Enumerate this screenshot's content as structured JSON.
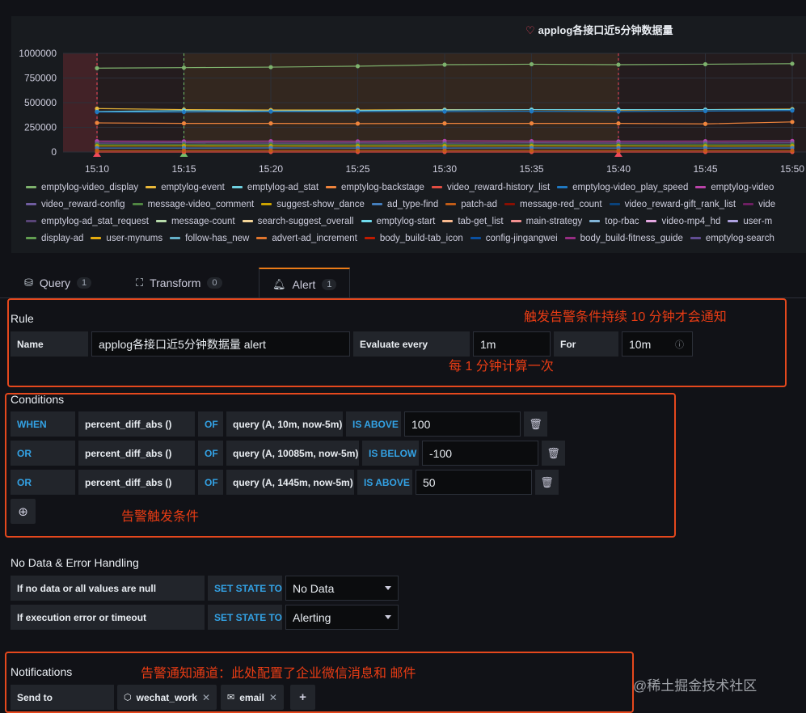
{
  "chart": {
    "title": "applog各接口近5分钟数据量"
  },
  "chart_data": {
    "type": "line",
    "title": "applog各接口近5分钟数据量",
    "x": [
      "15:10",
      "15:15",
      "15:20",
      "15:25",
      "15:30",
      "15:35",
      "15:40",
      "15:45",
      "15:50"
    ],
    "y_ticks": [
      "1000000",
      "750000",
      "500000",
      "250000",
      "0"
    ],
    "ylim": [
      0,
      1000000
    ],
    "grid": true,
    "legend_position": "bottom",
    "series": [
      {
        "name": "emptylog-video_display",
        "color": "#7eb26d",
        "values": [
          850000,
          855000,
          860000,
          870000,
          885000,
          890000,
          885000,
          890000,
          895000
        ]
      },
      {
        "name": "emptylog-event",
        "color": "#eab839",
        "values": [
          440000,
          430000,
          425000,
          425000,
          430000,
          430000,
          425000,
          430000,
          435000
        ]
      },
      {
        "name": "emptylog-ad_stat",
        "color": "#6ed0e0",
        "values": [
          410000,
          420000,
          415000,
          420000,
          425000,
          430000,
          430000,
          430000,
          430000
        ]
      },
      {
        "name": "emptylog-backstage",
        "color": "#ef843c",
        "values": [
          295000,
          290000,
          290000,
          288000,
          290000,
          290000,
          290000,
          285000,
          305000
        ]
      },
      {
        "name": "video_reward-history_list",
        "color": "#e24d42",
        "values": [
          0,
          0,
          0,
          0,
          0,
          0,
          0,
          0,
          0
        ]
      },
      {
        "name": "emptylog-video_play_speed",
        "color": "#1f78c1",
        "values": [
          405000,
          405000,
          410000,
          410000,
          410000,
          412000,
          410000,
          415000,
          420000
        ]
      },
      {
        "name": "video_reward-config",
        "color": "#ba43a9",
        "values": [
          110000,
          108000,
          110000,
          108000,
          112000,
          110000,
          108000,
          110000,
          112000
        ]
      },
      {
        "name": "message-video_comment",
        "color": "#705da0",
        "values": [
          90000,
          92000,
          90000,
          91000,
          90000,
          92000,
          90000,
          91000,
          92000
        ]
      },
      {
        "name": "suggest-show_dance",
        "color": "#508642",
        "values": [
          75000,
          76000,
          75000,
          74000,
          76000,
          75000,
          74000,
          75000,
          76000
        ]
      },
      {
        "name": "emptylog-start",
        "color": "#cca300",
        "values": [
          60000,
          61000,
          60000,
          59000,
          60000,
          61000,
          60000,
          59000,
          60000
        ]
      },
      {
        "name": "display-ad",
        "color": "#447ebc",
        "values": [
          40000,
          40000,
          41000,
          40000,
          40000,
          41000,
          40000,
          40000,
          41000
        ]
      },
      {
        "name": "user-mynums",
        "color": "#c15c17",
        "values": [
          15000,
          15000,
          15000,
          15000,
          15000,
          15000,
          15000,
          15000,
          15000
        ]
      }
    ],
    "annotations": [
      {
        "x_frac": 0.0,
        "color": "#f2495c"
      },
      {
        "x_frac": 0.125,
        "color": "#73bf69"
      },
      {
        "x_frac": 0.75,
        "color": "#f2495c"
      }
    ]
  },
  "legend": [
    [
      {
        "label": "emptylog-video_display",
        "color": "#7eb26d"
      },
      {
        "label": "emptylog-event",
        "color": "#eab839"
      },
      {
        "label": "emptylog-ad_stat",
        "color": "#6ed0e0"
      },
      {
        "label": "emptylog-backstage",
        "color": "#ef843c"
      },
      {
        "label": "video_reward-history_list",
        "color": "#e24d42"
      },
      {
        "label": "emptylog-video_play_speed",
        "color": "#1f78c1"
      },
      {
        "label": "emptylog-video",
        "color": "#ba43a9"
      }
    ],
    [
      {
        "label": "video_reward-config",
        "color": "#705da0"
      },
      {
        "label": "message-video_comment",
        "color": "#508642"
      },
      {
        "label": "suggest-show_dance",
        "color": "#cca300"
      },
      {
        "label": "ad_type-find",
        "color": "#447ebc"
      },
      {
        "label": "patch-ad",
        "color": "#c15c17"
      },
      {
        "label": "message-red_count",
        "color": "#890f02"
      },
      {
        "label": "video_reward-gift_rank_list",
        "color": "#0a437c"
      },
      {
        "label": "vide",
        "color": "#6d1f62"
      }
    ],
    [
      {
        "label": "emptylog-ad_stat_request",
        "color": "#584477"
      },
      {
        "label": "message-count",
        "color": "#b7dbab"
      },
      {
        "label": "search-suggest_overall",
        "color": "#f4d598"
      },
      {
        "label": "emptylog-start",
        "color": "#70dbed"
      },
      {
        "label": "tab-get_list",
        "color": "#f9ba8f"
      },
      {
        "label": "main-strategy",
        "color": "#f29191"
      },
      {
        "label": "top-rbac",
        "color": "#82b5d8"
      },
      {
        "label": "video-mp4_hd",
        "color": "#e5a8e2"
      },
      {
        "label": "user-m",
        "color": "#aea2e0"
      }
    ],
    [
      {
        "label": "display-ad",
        "color": "#629e51"
      },
      {
        "label": "user-mynums",
        "color": "#e5ac0e"
      },
      {
        "label": "follow-has_new",
        "color": "#64b0c8"
      },
      {
        "label": "advert-ad_increment",
        "color": "#e0752d"
      },
      {
        "label": "body_build-tab_icon",
        "color": "#bf1b00"
      },
      {
        "label": "config-jingangwei",
        "color": "#0a50a1"
      },
      {
        "label": "body_build-fitness_guide",
        "color": "#962d82"
      },
      {
        "label": "emptylog-search",
        "color": "#614d93"
      }
    ]
  ],
  "tabs": {
    "query": {
      "label": "Query",
      "count": "1"
    },
    "transform": {
      "label": "Transform",
      "count": "0"
    },
    "alert": {
      "label": "Alert",
      "count": "1"
    }
  },
  "rule": {
    "title": "Rule",
    "name_label": "Name",
    "name_value": "applog各接口近5分钟数据量 alert",
    "evaluate_label": "Evaluate every",
    "evaluate_value": "1m",
    "for_label": "For",
    "for_value": "10m"
  },
  "conditions": {
    "title": "Conditions",
    "rows": [
      {
        "op": "WHEN",
        "func": "percent_diff_abs ()",
        "of": "OF",
        "query": "query (A, 10m, now-5m)",
        "cmp": "IS ABOVE",
        "value": "100"
      },
      {
        "op": "OR",
        "func": "percent_diff_abs ()",
        "of": "OF",
        "query": "query (A, 10085m, now-5m)",
        "cmp": "IS BELOW",
        "value": "-100"
      },
      {
        "op": "OR",
        "func": "percent_diff_abs ()",
        "of": "OF",
        "query": "query (A, 1445m, now-5m)",
        "cmp": "IS ABOVE",
        "value": "50"
      }
    ]
  },
  "nodata": {
    "title": "No Data & Error Handling",
    "rows": [
      {
        "label": "If no data or all values are null",
        "set": "SET STATE TO",
        "value": "No Data"
      },
      {
        "label": "If execution error or timeout",
        "set": "SET STATE TO",
        "value": "Alerting"
      }
    ]
  },
  "notifications": {
    "title": "Notifications",
    "send_to_label": "Send to",
    "channels": [
      "wechat_work",
      "email"
    ]
  },
  "annotations": {
    "rule_for": "触发告警条件持续 10 分钟才会通知",
    "rule_eval": "每 1 分钟计算一次",
    "conditions": "告警触发条件",
    "notify": "告警通知通道：此处配置了企业微信消息和 邮件"
  },
  "watermark": "@稀土掘金技术社区"
}
